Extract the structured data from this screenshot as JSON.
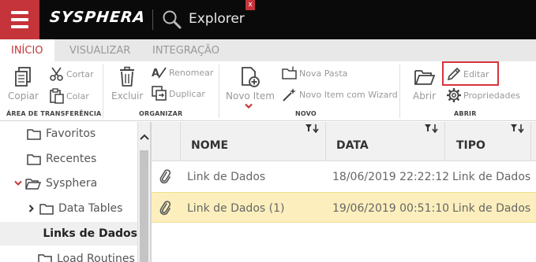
{
  "header": {
    "brand": "SYSPHERA",
    "app_title": "Explorer",
    "close_label": "x"
  },
  "tabs": [
    {
      "label": "INÍCIO",
      "active": true
    },
    {
      "label": "VISUALIZAR",
      "active": false
    },
    {
      "label": "INTEGRAÇÃO",
      "active": false
    }
  ],
  "ribbon": {
    "clipboard": {
      "group_label": "ÁREA DE TRANSFERÊNCIA",
      "copy": "Copiar",
      "cut": "Cortar",
      "paste": "Colar"
    },
    "organize": {
      "group_label": "ORGANIZAR",
      "delete": "Excluir",
      "rename": "Renomear",
      "duplicate": "Duplicar"
    },
    "new": {
      "group_label": "NOVO",
      "new_item": "Novo Item",
      "new_folder": "Nova Pasta",
      "new_item_wizard": "Novo Item com Wizard"
    },
    "open": {
      "group_label": "ABRIR",
      "open": "Abrir",
      "edit": "Editar",
      "properties": "Propriedades"
    }
  },
  "tree": {
    "items": [
      {
        "label": "Favoritos"
      },
      {
        "label": "Recentes"
      },
      {
        "label": "Sysphera"
      },
      {
        "label": "Data Tables"
      },
      {
        "label": "Links de Dados"
      },
      {
        "label": "Load Routines"
      }
    ]
  },
  "grid": {
    "columns": [
      "NOME",
      "DATA",
      "TIPO"
    ],
    "rows": [
      {
        "name": "Link de Dados",
        "date": "18/06/2019 22:22:12",
        "type": "Link de Dados"
      },
      {
        "name": "Link de Dados (1)",
        "date": "19/06/2019 00:51:10",
        "type": "Link de Dados"
      }
    ]
  },
  "colors": {
    "accent": "#c5343a",
    "highlight_box": "#d9333a",
    "selected_row": "#fcefbd",
    "topbar": "#0a0a0a"
  },
  "icons": [
    "menu-icon",
    "search-icon",
    "copy-icon",
    "scissors-icon",
    "paste-icon",
    "trash-icon",
    "rename-icon",
    "duplicate-icon",
    "new-item-icon",
    "new-folder-icon",
    "wand-icon",
    "folder-open-icon",
    "pencil-icon",
    "gear-icon",
    "folder-icon",
    "chevron-icon",
    "filter-icon",
    "paperclip-icon"
  ]
}
